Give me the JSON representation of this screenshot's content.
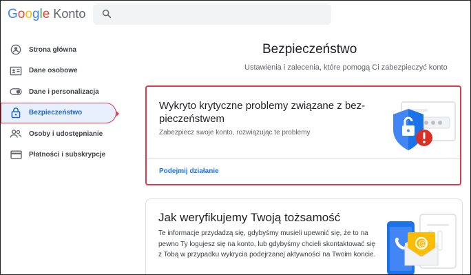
{
  "header": {
    "logo_google": [
      "G",
      "o",
      "o",
      "g",
      "l",
      "e"
    ],
    "logo_product": "Konto",
    "search_placeholder": ""
  },
  "sidebar": {
    "items": [
      {
        "label": "Strona główna",
        "icon": "home-person-icon"
      },
      {
        "label": "Dane osobowe",
        "icon": "id-card-icon"
      },
      {
        "label": "Dane i personalizacja",
        "icon": "toggle-icon"
      },
      {
        "label": "Bezpieczeństwo",
        "icon": "lock-icon",
        "active": true
      },
      {
        "label": "Osoby i udostępnianie",
        "icon": "people-icon"
      },
      {
        "label": "Płatności i subskrypcje",
        "icon": "credit-card-icon"
      }
    ]
  },
  "main": {
    "title": "Bezpieczeństwo",
    "subtitle": "Ustawienia i zalecenia, które pomogą Ci zabezpieczyć konto"
  },
  "issue_card": {
    "title": "Wykryto krytyczne problemy związane z bez- pieczeństwem",
    "description": "Zabezpiecz swoje konto, rozwiązując te problemy",
    "action": "Podejmij działanie"
  },
  "verify_card": {
    "title": "Jak weryfikujemy Twoją tożsamość",
    "description": "Te informacje przydadzą się, gdybyśmy musieli upewnić się, że to na pewno Ty logujesz się na konto, lub gdybyśmy chcieli skontaktować się z Tobą w przypadku wykrycia podejrzanej aktywności na Twoim koncie."
  },
  "colors": {
    "accent": "#1a73e8",
    "active_bg": "#e8f0fe",
    "highlight_border": "#e03a4a",
    "alert_red": "#d93025",
    "shield_blue": "#4285f4"
  }
}
